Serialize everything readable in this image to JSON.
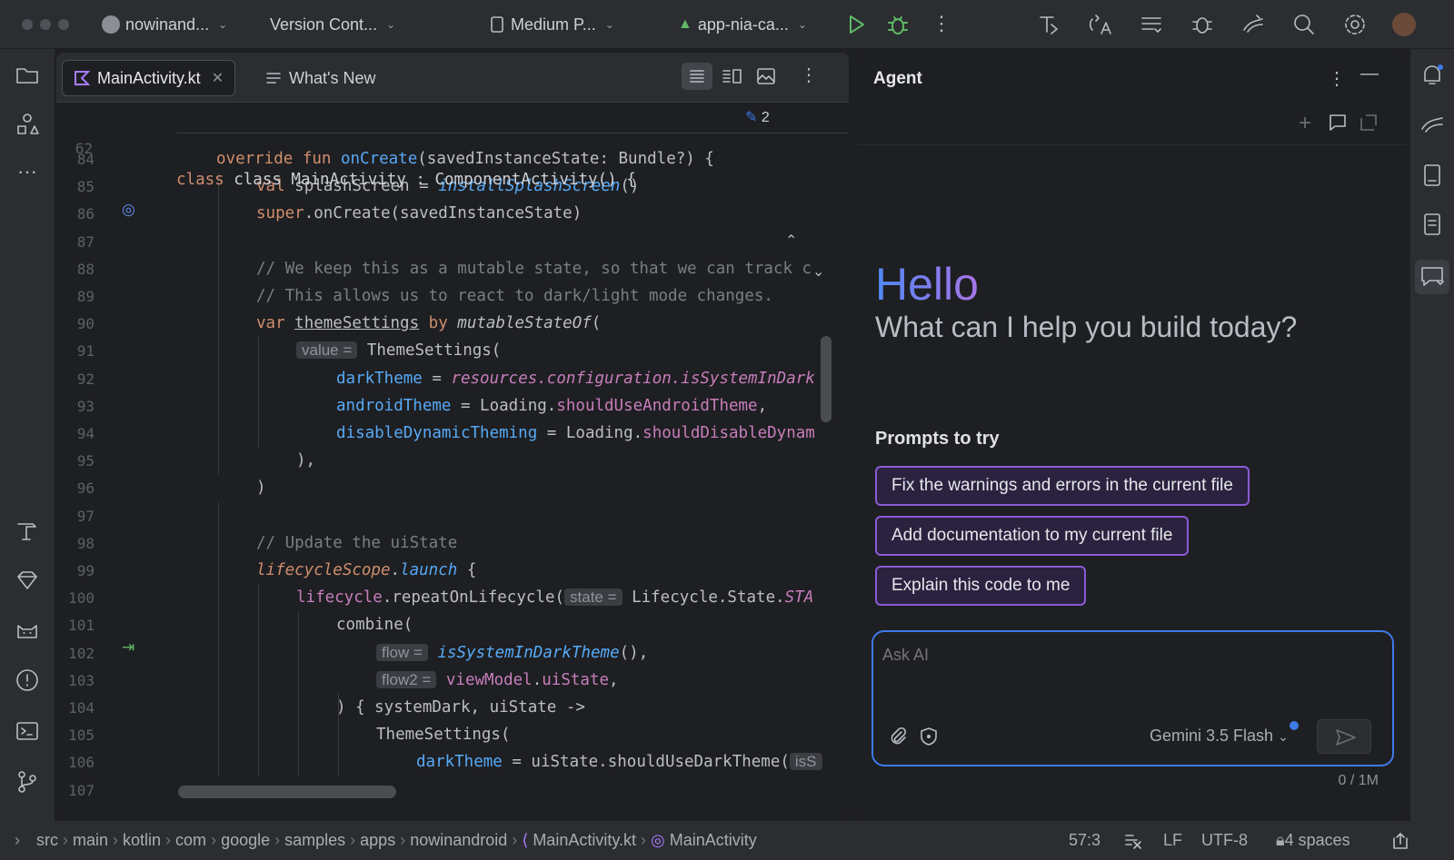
{
  "titlebar": {
    "project": "nowinand...",
    "vcs": "Version Cont...",
    "device": "Medium P...",
    "run_config": "app-nia-ca..."
  },
  "editor": {
    "tabs": [
      {
        "label": "MainActivity.kt",
        "active": true
      },
      {
        "label": "What's New",
        "active": false
      }
    ],
    "sticky_line": "62",
    "sticky_code": "class MainActivity : ComponentActivity() {",
    "edit_count": "2",
    "lines": [
      "84",
      "85",
      "86",
      "87",
      "88",
      "89",
      "90",
      "91",
      "92",
      "93",
      "94",
      "95",
      "96",
      "97",
      "98",
      "99",
      "100",
      "101",
      "102",
      "103",
      "104",
      "105",
      "106",
      "107"
    ],
    "hints": {
      "value": "value =",
      "state": "state =",
      "flow": "flow =",
      "flow2": "flow2 =",
      "isS": "isS"
    },
    "code": {
      "l84a": "override fun ",
      "l84b": "onCreate",
      "l84c": "(savedInstanceState: Bundle?) {",
      "l85a": "val ",
      "l85b": "splashScreen = ",
      "l85c": "installSplashScreen",
      "l85d": "()",
      "l86a": "super",
      "l86b": ".onCreate(savedInstanceState)",
      "l88": "// We keep this as a mutable state, so that we can track c",
      "l89": "// This allows us to react to dark/light mode changes.",
      "l90a": "var ",
      "l90b": "themeSettings",
      "l90c": " by ",
      "l90d": "mutableStateOf",
      "l91": "ThemeSettings(",
      "l92a": "darkTheme",
      "l92b": " = ",
      "l92c": "resources.configuration.isSystemInDark",
      "l93a": "androidTheme",
      "l93b": " = Loading.",
      "l93c": "shouldUseAndroidTheme",
      "l93d": ",",
      "l94a": "disableDynamicTheming",
      "l94b": " = Loading.",
      "l94c": "shouldDisableDynam",
      "l95": "),",
      "l96": ")",
      "l98": "// Update the uiState",
      "l99a": "lifecycleScope",
      "l99b": ".",
      "l99c": "launch",
      "l99d": " {",
      "l100a": "lifecycle",
      "l100b": ".repeatOnLifecycle(",
      "l100c": "Lifecycle.State.",
      "l100d": "STA",
      "l101": "combine(",
      "l102a": "isSystemInDarkTheme",
      "l102b": "(),",
      "l103a": "viewModel",
      "l103b": ".",
      "l103c": "uiState",
      "l103d": ",",
      "l104": ") { systemDark, uiState ->",
      "l105": "ThemeSettings(",
      "l106a": "darkTheme",
      "l106b": " = uiState.shouldUseDarkTheme("
    }
  },
  "agent": {
    "title": "Agent",
    "hello": "Hello",
    "subtitle": "What can I help you build today?",
    "prompts_heading": "Prompts to try",
    "prompts": [
      "Fix the warnings and errors in the current file",
      "Add documentation to my current file",
      "Explain this code to me"
    ],
    "input_placeholder": "Ask AI",
    "model": "Gemini 3.5 Flash",
    "token_count": "0 / 1M"
  },
  "statusbar": {
    "breadcrumbs": [
      "src",
      "main",
      "kotlin",
      "com",
      "google",
      "samples",
      "apps",
      "nowinandroid",
      "MainActivity.kt",
      "MainActivity"
    ],
    "position": "57:3",
    "line_ending": "LF",
    "encoding": "UTF-8",
    "indent": "4 spaces"
  },
  "colors": {
    "accent": "#3d7ae8",
    "prompt_border": "#8a5bd6",
    "run_green": "#5fb865"
  }
}
